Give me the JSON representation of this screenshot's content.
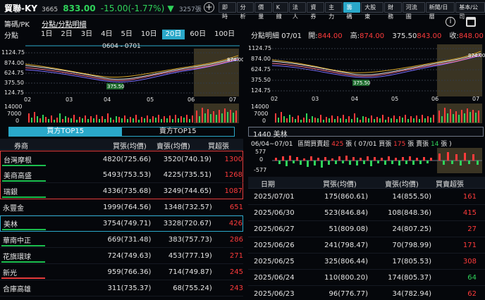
{
  "header": {
    "stock_name": "貿聯-KY",
    "code": "3665",
    "price": "833.00",
    "change": "-15.00(-1.77%)",
    "direction_icon": "down-triangle",
    "volume": "3257張",
    "tabs": [
      "即時",
      "分析",
      "價量",
      "K線",
      "法人",
      "資券",
      "主力",
      "籌碼",
      "大股東",
      "財務",
      "河流圖",
      "新聞/日曆",
      "基本/公司"
    ],
    "active_tab": "籌碼"
  },
  "subheader": {
    "left_title": "籌碼/PK",
    "left_link": "分點/分點明細"
  },
  "left_panel": {
    "title": "分點",
    "range_buttons": [
      "1日",
      "2日",
      "3日",
      "4日",
      "5日",
      "10日",
      "20日",
      "60日",
      "100日"
    ],
    "active_range": "20日",
    "date_range_label": "0604 - 0701",
    "price_ticks": [
      "1124.75",
      "874.00",
      "624.75",
      "375.50",
      "124.75"
    ],
    "volume_ticks": [
      "14000",
      "7000",
      "0"
    ],
    "x_ticks": [
      "02",
      "03",
      "04",
      "05",
      "06",
      "07"
    ],
    "last_price_label": "874.00",
    "low_label": "375.50",
    "tabs": [
      "買方TOP15",
      "賣方TOP15"
    ],
    "active_tab": "買方TOP15",
    "table_headers": [
      "券商",
      "買張(均價)",
      "賣張(均價)",
      "買超張"
    ],
    "rows": [
      {
        "name": "台灣摩根",
        "buy": "4820(725.66)",
        "sell": "3520(740.19)",
        "net": "1300"
      },
      {
        "name": "美商高盛",
        "buy": "5493(753.53)",
        "sell": "4225(735.51)",
        "net": "1268"
      },
      {
        "name": "瑞銀",
        "buy": "4336(735.68)",
        "sell": "3249(744.65)",
        "net": "1087"
      },
      {
        "name": "永豐金",
        "buy": "1999(764.56)",
        "sell": "1348(732.57)",
        "net": "651"
      },
      {
        "name": "美林",
        "buy": "3754(749.71)",
        "sell": "3328(720.67)",
        "net": "426"
      },
      {
        "name": "華南中正",
        "buy": "669(731.48)",
        "sell": "383(757.73)",
        "net": "286"
      },
      {
        "name": "花旗環球",
        "buy": "724(749.63)",
        "sell": "453(777.19)",
        "net": "271"
      },
      {
        "name": "新光",
        "buy": "959(766.36)",
        "sell": "714(749.87)",
        "net": "245"
      },
      {
        "name": "合庫高雄",
        "buy": "311(735.37)",
        "sell": "68(755.24)",
        "net": "243"
      }
    ]
  },
  "right_panel": {
    "title": "分點明細",
    "date": "07/01",
    "open_label": "開:",
    "open": "844.00",
    "high_label": "高:",
    "high": "874.00",
    "low_label": "375.50",
    "low": "843.00",
    "close_label": "收:",
    "close": "848.00",
    "price_ticks": [
      "1124.75",
      "874.00",
      "624.75",
      "375.50",
      "124.75"
    ],
    "volume_ticks": [
      "14000",
      "7000",
      "0"
    ],
    "x_ticks": [
      "02",
      "03",
      "04",
      "05",
      "06",
      "07"
    ],
    "last_price_label": "874.00",
    "broker_select": "1440 美林",
    "summary": {
      "range": "06/04~07/01",
      "text1": "區間買賣超",
      "net": "425",
      "text2": "張 ( 07/01 買張",
      "buy": "175",
      "text3": "張 賣張",
      "sell": "14",
      "text4": "張 )"
    },
    "bar_ticks": [
      "577",
      "0",
      "-577"
    ],
    "table_headers": [
      "日期",
      "買張(均價)",
      "賣張(均價)",
      "買賣超張"
    ],
    "rows": [
      {
        "date": "2025/07/01",
        "buy": "175(860.61)",
        "sell": "14(855.50)",
        "net": "161",
        "net_color": "red"
      },
      {
        "date": "2025/06/30",
        "buy": "523(846.84)",
        "sell": "108(848.36)",
        "net": "415",
        "net_color": "red"
      },
      {
        "date": "2025/06/27",
        "buy": "51(809.08)",
        "sell": "24(807.25)",
        "net": "27",
        "net_color": "red"
      },
      {
        "date": "2025/06/26",
        "buy": "241(798.47)",
        "sell": "70(798.99)",
        "net": "171",
        "net_color": "red"
      },
      {
        "date": "2025/06/25",
        "buy": "325(806.44)",
        "sell": "17(805.53)",
        "net": "308",
        "net_color": "red"
      },
      {
        "date": "2025/06/24",
        "buy": "110(800.20)",
        "sell": "174(805.37)",
        "net": "64",
        "net_color": "green"
      },
      {
        "date": "2025/06/23",
        "buy": "96(776.77)",
        "sell": "34(782.94)",
        "net": "62",
        "net_color": "red"
      }
    ]
  }
}
